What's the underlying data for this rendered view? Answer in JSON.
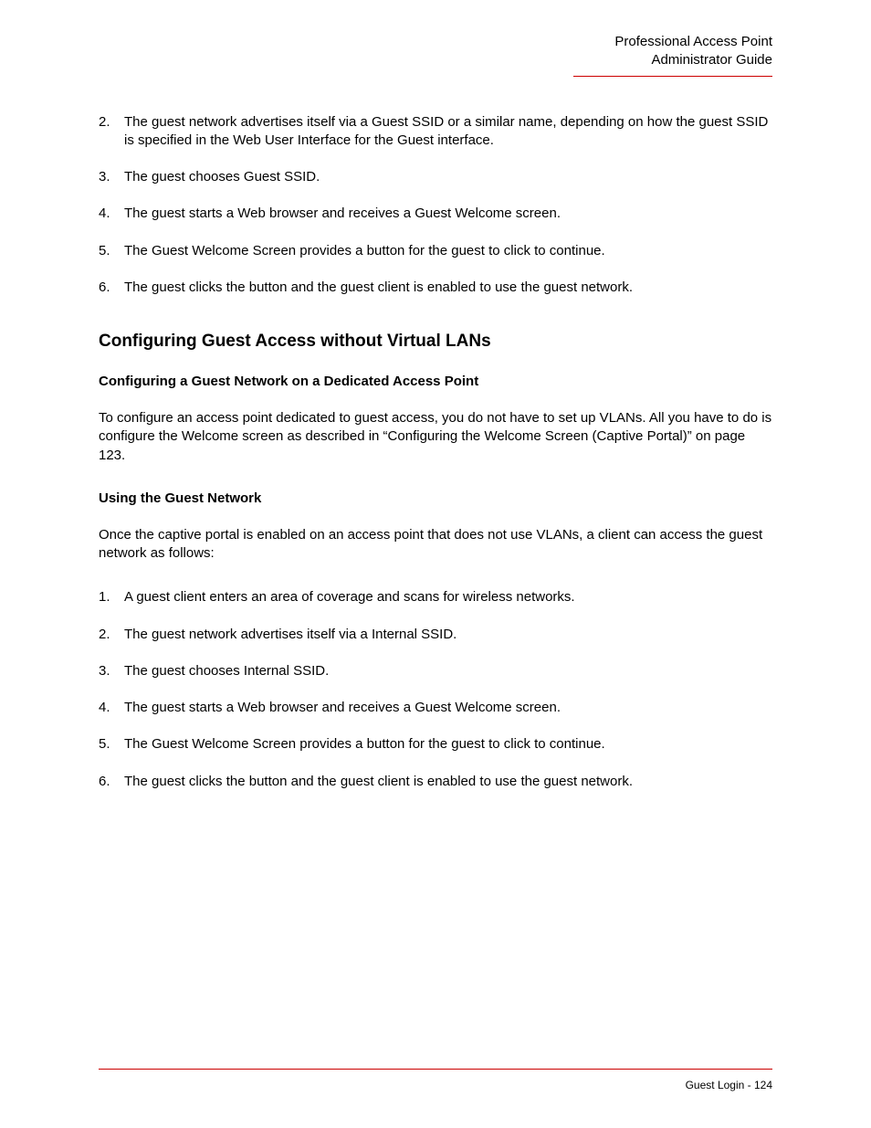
{
  "header": {
    "line1": "Professional Access Point",
    "line2": "Administrator Guide"
  },
  "list1": [
    {
      "n": "2.",
      "t": "The guest network advertises itself via a Guest SSID or a similar name, depending on how the guest SSID is specified in the Web User Interface for the Guest interface."
    },
    {
      "n": "3.",
      "t": "The guest chooses Guest SSID."
    },
    {
      "n": "4.",
      "t": "The guest starts a Web browser and receives a Guest Welcome screen."
    },
    {
      "n": "5.",
      "t": "The Guest Welcome Screen provides a button for the guest to click to continue."
    },
    {
      "n": "6.",
      "t": "The guest clicks the button and the guest client is enabled to use the guest network."
    }
  ],
  "section_title": "Configuring Guest Access without Virtual LANs",
  "sub1_title": "Configuring a Guest Network on a Dedicated Access Point",
  "sub1_body": "To configure an access point dedicated to guest access, you do not have to set up VLANs. All you have to do is configure the Welcome screen as described in “Configuring the Welcome Screen (Captive Portal)” on page 123.",
  "sub2_title": "Using the Guest Network",
  "sub2_body": "Once the captive portal is enabled on an access point that does not use VLANs, a client can access the guest network as follows:",
  "list2": [
    {
      "n": "1.",
      "t": "A guest client enters an area of coverage and scans for wireless networks."
    },
    {
      "n": "2.",
      "t": "The guest network advertises itself via a Internal SSID."
    },
    {
      "n": "3.",
      "t": "The guest chooses Internal SSID."
    },
    {
      "n": "4.",
      "t": "The guest starts a Web browser and receives a Guest Welcome screen."
    },
    {
      "n": "5.",
      "t": "The Guest Welcome Screen provides a button for the guest to click to continue."
    },
    {
      "n": "6.",
      "t": "The guest clicks the button and the guest client is enabled to use the guest network."
    }
  ],
  "footer": "Guest Login - 124"
}
